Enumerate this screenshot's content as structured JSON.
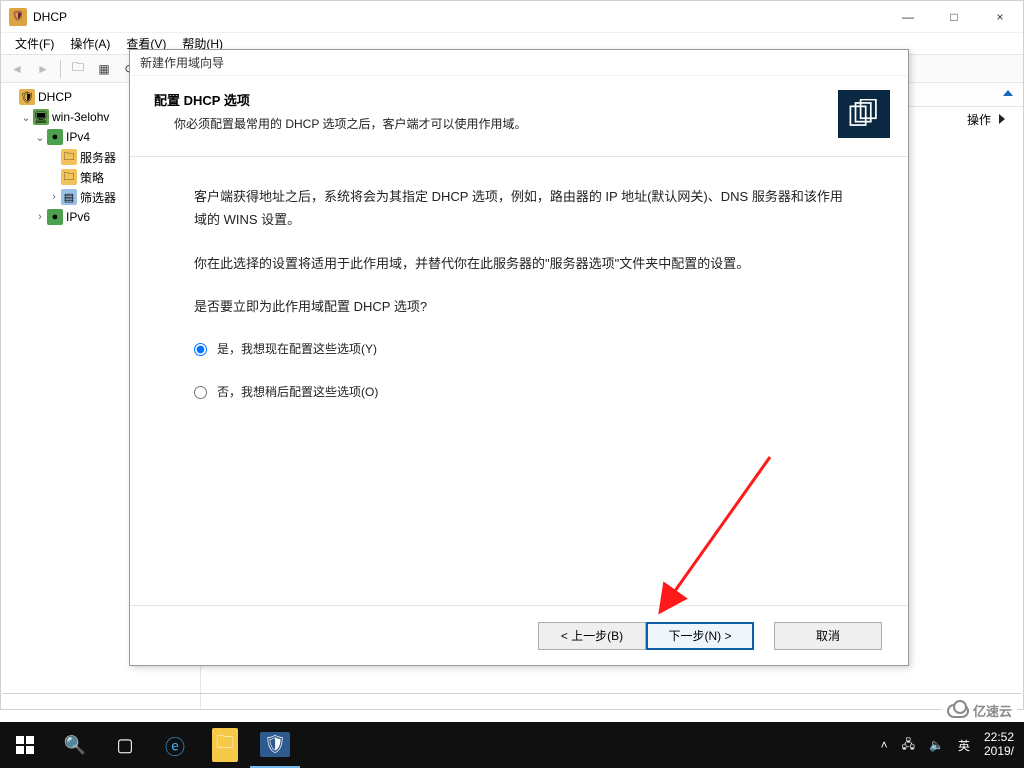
{
  "window": {
    "title": "DHCP",
    "min_tooltip": "—",
    "max_tooltip": "□",
    "close_tooltip": "×"
  },
  "menu": {
    "file": "文件(F)",
    "action": "操作(A)",
    "view": "查看(V)",
    "help": "帮助(H)"
  },
  "tree": {
    "root": "DHCP",
    "server": "win-3elohv",
    "ipv4": "IPv4",
    "server_options": "服务器",
    "policies": "策略",
    "filters": "筛选器",
    "ipv6": "IPv6"
  },
  "right_pane": {
    "header_blank": "",
    "action_label": "操作"
  },
  "wizard": {
    "window_title": "新建作用域向导",
    "header_title": "配置 DHCP 选项",
    "header_sub": "你必须配置最常用的 DHCP 选项之后，客户端才可以使用作用域。",
    "body_p1": "客户端获得地址之后，系统将会为其指定 DHCP 选项，例如，路由器的 IP 地址(默认网关)、DNS 服务器和该作用域的 WINS 设置。",
    "body_p2": "你在此选择的设置将适用于此作用域，并替代你在此服务器的\"服务器选项\"文件夹中配置的设置。",
    "body_q": "是否要立即为此作用域配置 DHCP 选项?",
    "radio_yes": "是，我想现在配置这些选项(Y)",
    "radio_no": "否，我想稍后配置这些选项(O)",
    "btn_back": "< 上一步(B)",
    "btn_next": "下一步(N) >",
    "btn_cancel": "取消"
  },
  "taskbar": {
    "ime": "英",
    "time": "22:52",
    "date": "2019/"
  },
  "watermark": "亿速云"
}
